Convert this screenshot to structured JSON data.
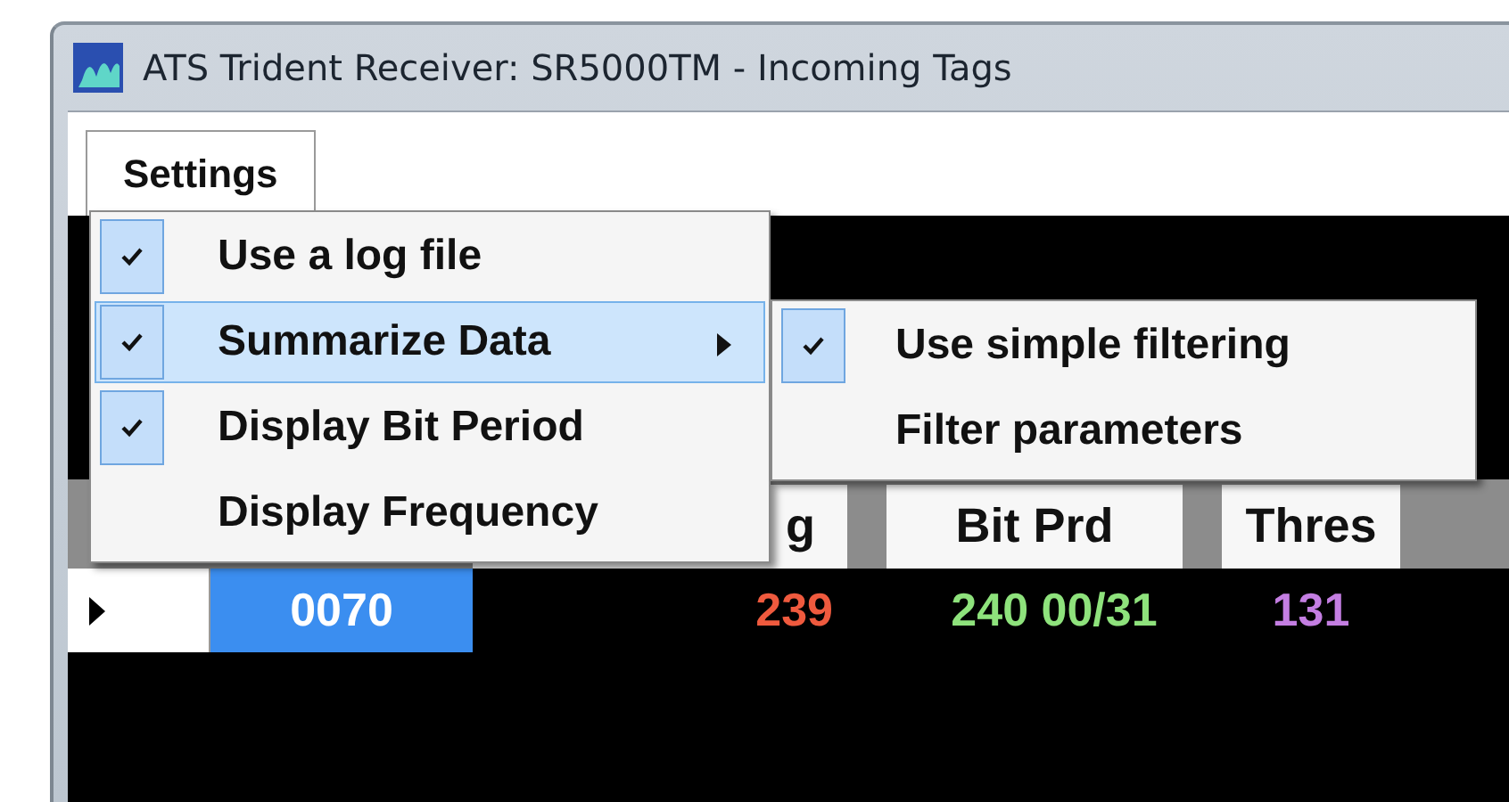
{
  "window": {
    "title": "ATS Trident Receiver: SR5000TM - Incoming Tags"
  },
  "menu_bar": [
    {
      "label": "Settings"
    }
  ],
  "settings_menu": {
    "items": [
      {
        "label": "Use a log file",
        "checked": true,
        "highlighted": false,
        "submenu": false
      },
      {
        "label": "Summarize Data",
        "checked": true,
        "highlighted": true,
        "submenu": true
      },
      {
        "label": "Display Bit Period",
        "checked": true,
        "highlighted": false,
        "submenu": false
      },
      {
        "label": "Display Frequency",
        "checked": false,
        "highlighted": false,
        "submenu": false
      }
    ]
  },
  "summarize_submenu": {
    "items": [
      {
        "label": "Use simple filtering",
        "checked": true
      },
      {
        "label": "Filter parameters",
        "checked": false
      }
    ]
  },
  "table": {
    "columns": [
      "",
      "g",
      "Bit Prd",
      "Thres"
    ],
    "rows": [
      {
        "current": true,
        "cells": [
          {
            "text": "0070",
            "selected": true,
            "color": "#ffffff"
          },
          {
            "text": "239",
            "selected": false,
            "color": "#ef5a3e"
          },
          {
            "text": "240 00/31",
            "selected": false,
            "color": "#8ee27c"
          },
          {
            "text": "131",
            "selected": false,
            "color": "#c47ee2"
          }
        ]
      }
    ]
  }
}
